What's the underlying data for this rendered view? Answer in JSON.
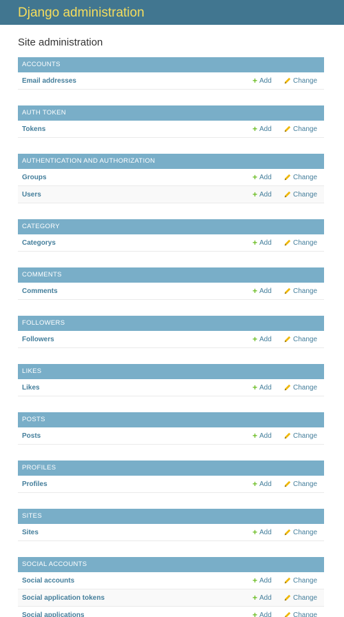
{
  "header": {
    "branding": "Django administration"
  },
  "page": {
    "title": "Site administration"
  },
  "actions": {
    "add_label": "Add",
    "change_label": "Change"
  },
  "colors": {
    "header_bg": "#417690",
    "branding": "#f5dd5d",
    "caption_bg": "#79aec8",
    "link": "#447e9b",
    "add_icon": "#70bf2b",
    "change_icon": "#efb80b"
  },
  "icons": {
    "add": "plus-icon",
    "change": "pencil-icon"
  },
  "apps": [
    {
      "caption": "Accounts",
      "models": [
        "Email addresses"
      ]
    },
    {
      "caption": "Auth Token",
      "models": [
        "Tokens"
      ]
    },
    {
      "caption": "Authentication and Authorization",
      "models": [
        "Groups",
        "Users"
      ]
    },
    {
      "caption": "Category",
      "models": [
        "Categorys"
      ]
    },
    {
      "caption": "Comments",
      "models": [
        "Comments"
      ]
    },
    {
      "caption": "Followers",
      "models": [
        "Followers"
      ]
    },
    {
      "caption": "Likes",
      "models": [
        "Likes"
      ]
    },
    {
      "caption": "Posts",
      "models": [
        "Posts"
      ]
    },
    {
      "caption": "Profiles",
      "models": [
        "Profiles"
      ]
    },
    {
      "caption": "Sites",
      "models": [
        "Sites"
      ]
    },
    {
      "caption": "Social Accounts",
      "models": [
        "Social accounts",
        "Social application tokens",
        "Social applications"
      ]
    }
  ]
}
